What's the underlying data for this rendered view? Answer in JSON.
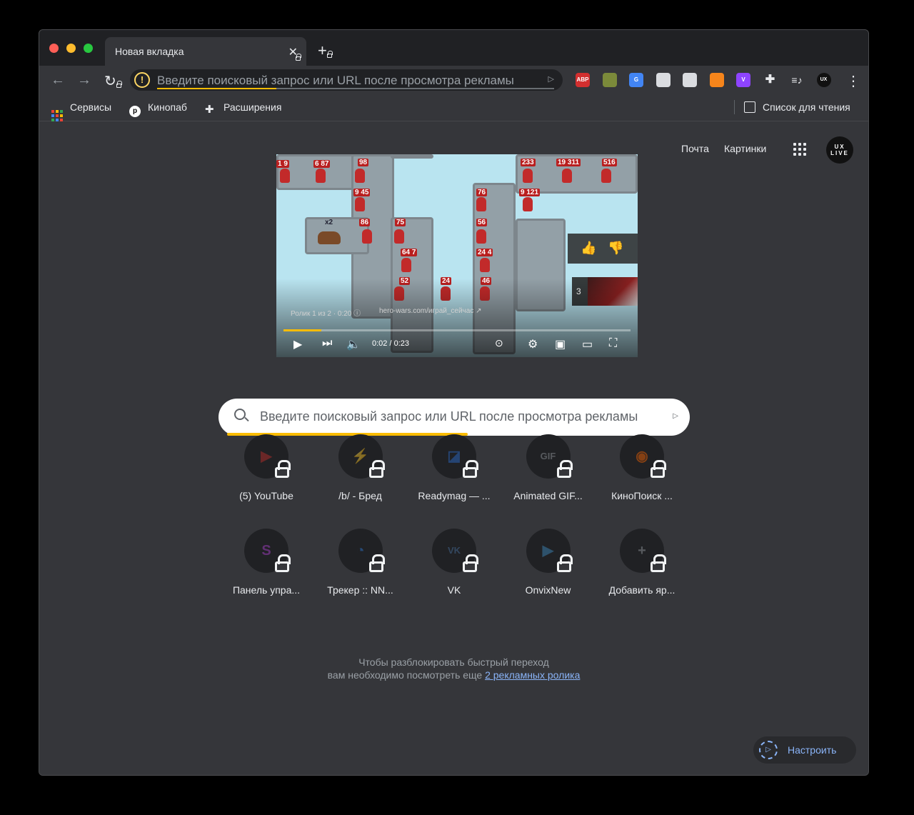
{
  "tab": {
    "title": "Новая вкладка",
    "close": "✕",
    "new_tab": "+"
  },
  "toolbar": {
    "back": "←",
    "forward": "→",
    "reload": "↻",
    "omnibox_placeholder": "Введите поисковый запрос или URL после просмотра рекламы",
    "omnibox_progress": 0.3,
    "extensions": [
      {
        "name": "abp-icon",
        "label": "ABP",
        "color": "#d32f2f"
      },
      {
        "name": "color-picker-icon",
        "label": "",
        "color": "#7b8a3a"
      },
      {
        "name": "google-translate-icon",
        "label": "G",
        "color": "#4285f4"
      },
      {
        "name": "screenshot-icon",
        "label": "",
        "color": "#dadce0"
      },
      {
        "name": "image-icon",
        "label": "",
        "color": "#dadce0"
      },
      {
        "name": "metamask-icon",
        "label": "",
        "color": "#f6851b"
      },
      {
        "name": "vimeo-icon",
        "label": "V",
        "color": "#8e44ff"
      },
      {
        "name": "puzzle-icon",
        "label": "",
        "color": "transparent"
      },
      {
        "name": "media-icon",
        "label": "",
        "color": "transparent"
      },
      {
        "name": "profile-icon",
        "label": "UX",
        "color": "#111111"
      }
    ]
  },
  "bookmarks": {
    "services": "Сервисы",
    "kinopub": "Кинопаб",
    "extensions": "Расширения",
    "reading_list": "Список для чтения"
  },
  "header": {
    "mail": "Почта",
    "images": "Картинки",
    "avatar_text": "UX LIVE"
  },
  "video": {
    "info": "Ролик 1 из 2 · 0:20 ⓘ",
    "link": "hero-wars.com/играй_сейчас ↗",
    "time": "0:02 / 0:23",
    "progress": 0.11,
    "next_count": "3",
    "multiplier": "x2"
  },
  "search": {
    "placeholder": "Введите поисковый запрос или URL после просмотра рекламы",
    "progress": 0.53
  },
  "shortcuts": [
    {
      "label": "(5) YouTube",
      "icon": "youtube-icon",
      "glyph": "▶",
      "color": "#c4302b"
    },
    {
      "label": "/b/ - Бред",
      "icon": "bolt-icon",
      "glyph": "⚡",
      "color": "#e8a33a"
    },
    {
      "label": "Readymag — ...",
      "icon": "readymag-icon",
      "glyph": "◪",
      "color": "#2d6fd4"
    },
    {
      "label": "Animated GIF...",
      "icon": "gif-icon",
      "glyph": "GIF",
      "color": "#9aa0a6"
    },
    {
      "label": "КиноПоиск ...",
      "icon": "kinopoisk-icon",
      "glyph": "◉",
      "color": "#ff6600"
    },
    {
      "label": "Панель упра...",
      "icon": "panel-icon",
      "glyph": "S",
      "color": "#b041d4"
    },
    {
      "label": "Трекер :: NN...",
      "icon": "tracker-icon",
      "glyph": "◔",
      "color": "#2f7bd8"
    },
    {
      "label": "VK",
      "icon": "vk-icon",
      "glyph": "VK",
      "color": "#4a76a8"
    },
    {
      "label": "OnvixNew",
      "icon": "onvix-icon",
      "glyph": "▶",
      "color": "#3f8fc4"
    },
    {
      "label": "Добавить яр...",
      "icon": "plus-icon",
      "glyph": "+",
      "color": "#9aa0a6"
    }
  ],
  "unlock": {
    "line1": "Чтобы разблокировать быстрый переход",
    "line2": "вам необходимо посмотреть еще",
    "link": "2 рекламных ролика"
  },
  "customize": {
    "label": "Настроить"
  }
}
